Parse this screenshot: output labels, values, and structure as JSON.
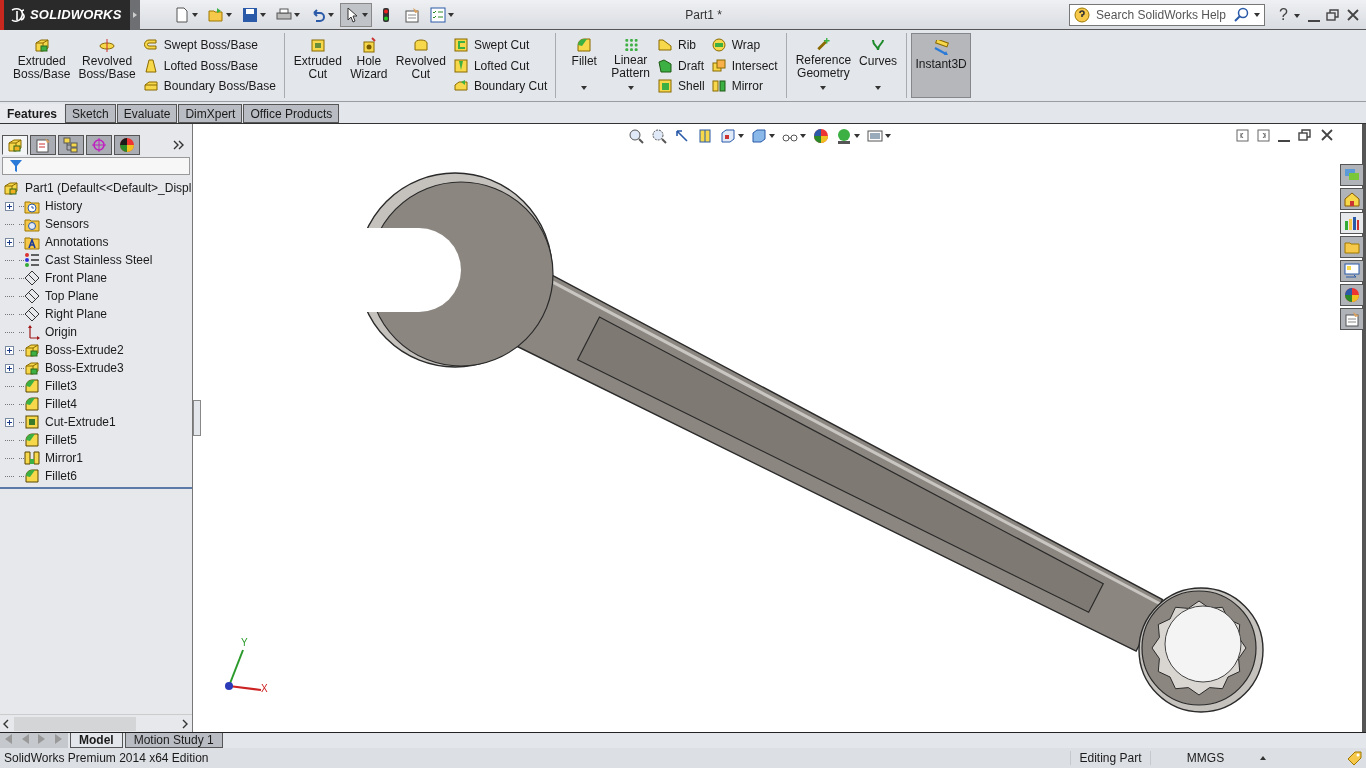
{
  "app": {
    "logo": "SOLIDWORKS"
  },
  "window": {
    "title": "Part1 *"
  },
  "search": {
    "placeholder": "Search SolidWorks Help"
  },
  "help_glyph": "?",
  "ribbon": {
    "groups": [
      {
        "buttons": [
          {
            "kind": "large",
            "label": "Extruded\nBoss/Base",
            "dropdown": false
          },
          {
            "kind": "large",
            "label": "Revolved\nBoss/Base",
            "dropdown": false
          },
          {
            "kind": "small",
            "label": "Swept Boss/Base",
            "dropdown": false
          },
          {
            "kind": "small",
            "label": "Lofted Boss/Base",
            "dropdown": false
          },
          {
            "kind": "small",
            "label": "Boundary Boss/Base",
            "dropdown": false
          }
        ]
      },
      {
        "buttons": [
          {
            "kind": "large",
            "label": "Extruded\nCut",
            "dropdown": false
          },
          {
            "kind": "large",
            "label": "Hole\nWizard",
            "dropdown": false
          },
          {
            "kind": "large",
            "label": "Revolved\nCut",
            "dropdown": false
          },
          {
            "kind": "small",
            "label": "Swept Cut",
            "dropdown": false
          },
          {
            "kind": "small",
            "label": "Lofted Cut",
            "dropdown": false
          },
          {
            "kind": "small",
            "label": "Boundary Cut",
            "dropdown": false
          }
        ]
      },
      {
        "buttons": [
          {
            "kind": "large",
            "label": "Fillet",
            "dropdown": true
          },
          {
            "kind": "large",
            "label": "Linear\nPattern",
            "dropdown": true
          },
          {
            "kind": "small",
            "label": "Rib",
            "dropdown": false
          },
          {
            "kind": "small",
            "label": "Draft",
            "dropdown": false
          },
          {
            "kind": "small",
            "label": "Shell",
            "dropdown": false
          },
          {
            "kind": "small",
            "label": "Wrap",
            "dropdown": false
          },
          {
            "kind": "small",
            "label": "Intersect",
            "dropdown": false
          },
          {
            "kind": "small",
            "label": "Mirror",
            "dropdown": false
          }
        ]
      },
      {
        "buttons": [
          {
            "kind": "large",
            "label": "Reference\nGeometry",
            "dropdown": true
          },
          {
            "kind": "large",
            "label": "Curves",
            "dropdown": true
          }
        ]
      }
    ],
    "toggle": {
      "label": "Instant3D",
      "on": true
    }
  },
  "tabs": [
    {
      "label": "Features",
      "selected": true
    },
    {
      "label": "Sketch",
      "selected": false
    },
    {
      "label": "Evaluate",
      "selected": false
    },
    {
      "label": "DimXpert",
      "selected": false
    },
    {
      "label": "Office Products",
      "selected": false
    }
  ],
  "manager_tabs": [
    {
      "selected": true
    },
    {
      "selected": false
    },
    {
      "selected": false
    },
    {
      "selected": false
    },
    {
      "selected": false
    }
  ],
  "tree": {
    "label": "Part1  (Default<<Default>_Displ",
    "children": [
      {
        "label": "History",
        "kind": "history",
        "expandable": true
      },
      {
        "label": "Sensors",
        "kind": "sensors",
        "expandable": false
      },
      {
        "label": "Annotations",
        "kind": "annotations",
        "expandable": true
      },
      {
        "label": "Cast Stainless Steel",
        "kind": "material",
        "expandable": false
      },
      {
        "label": "Front Plane",
        "kind": "plane",
        "expandable": false
      },
      {
        "label": "Top Plane",
        "kind": "plane",
        "expandable": false
      },
      {
        "label": "Right Plane",
        "kind": "plane",
        "expandable": false
      },
      {
        "label": "Origin",
        "kind": "origin",
        "expandable": false
      },
      {
        "label": "Boss-Extrude2",
        "kind": "boss",
        "expandable": true
      },
      {
        "label": "Boss-Extrude3",
        "kind": "boss",
        "expandable": true
      },
      {
        "label": "Fillet3",
        "kind": "fillet",
        "expandable": false
      },
      {
        "label": "Fillet4",
        "kind": "fillet",
        "expandable": false
      },
      {
        "label": "Cut-Extrude1",
        "kind": "cut",
        "expandable": true
      },
      {
        "label": "Fillet5",
        "kind": "fillet",
        "expandable": false
      },
      {
        "label": "Mirror1",
        "kind": "mirror",
        "expandable": false
      },
      {
        "label": "Fillet6",
        "kind": "fillet",
        "expandable": false
      }
    ]
  },
  "triad": {
    "y_label": "Y",
    "x_label": "X"
  },
  "bottom_tabs": [
    {
      "label": "Model",
      "selected": true
    },
    {
      "label": "Motion Study 1",
      "selected": false
    }
  ],
  "status_bar": {
    "edition": "SolidWorks Premium 2014 x64 Edition",
    "mode": "Editing Part",
    "units": "MMGS"
  }
}
